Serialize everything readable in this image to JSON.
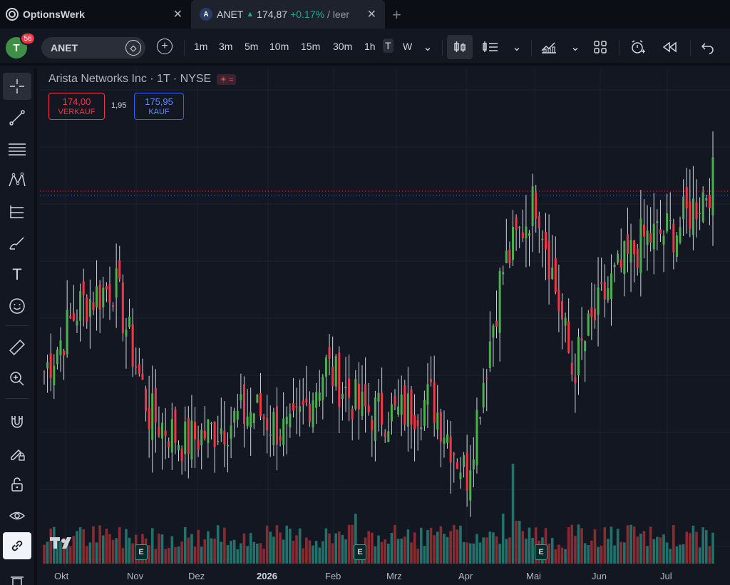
{
  "tabs": [
    {
      "title": "OptionsWerk"
    },
    {
      "symbol": "ANET",
      "price": "174,87",
      "change": "+0.17%",
      "extra": "/ leer"
    }
  ],
  "toolbar": {
    "avatar_letter": "T",
    "notifications": "56",
    "symbol": "ANET",
    "timeframes": [
      "1m",
      "3m",
      "5m",
      "10m",
      "15m",
      "30m",
      "1h",
      "T",
      "W"
    ],
    "active_timeframe": "T"
  },
  "chart": {
    "legend_title": "Arista Networks Inc · 1T · NYSE",
    "sell_price": "174,00",
    "sell_label": "VERKAUF",
    "spread": "1,95",
    "buy_price": "175,95",
    "buy_label": "KAUF",
    "watermark": "17",
    "x_labels": [
      "Okt",
      "Nov",
      "Dez",
      "2026",
      "Feb",
      "Mrz",
      "Apr",
      "Mai",
      "Jun",
      "Jul"
    ],
    "earnings_marker": "E"
  },
  "chart_data": {
    "type": "candlestick",
    "title": "Arista Networks Inc · 1T · NYSE",
    "x_labels": [
      "Okt",
      "Nov",
      "Dez",
      "2026",
      "Feb",
      "Mrz",
      "Apr",
      "Mai",
      "Jun",
      "Jul"
    ],
    "approx_close_trend": [
      {
        "month": "Okt",
        "close": 140
      },
      {
        "month": "Okt-mid",
        "close": 152
      },
      {
        "month": "Nov",
        "close": 156
      },
      {
        "month": "Nov-mid",
        "close": 132
      },
      {
        "month": "Dez",
        "close": 127
      },
      {
        "month": "Dez-mid",
        "close": 130
      },
      {
        "month": "2026",
        "close": 133
      },
      {
        "month": "Jan-mid",
        "close": 128
      },
      {
        "month": "Feb",
        "close": 141
      },
      {
        "month": "Feb-mid",
        "close": 133
      },
      {
        "month": "Mrz",
        "close": 132
      },
      {
        "month": "Mrz-mid",
        "close": 135
      },
      {
        "month": "Apr",
        "close": 121
      },
      {
        "month": "Apr-mid",
        "close": 158
      },
      {
        "month": "Mai",
        "close": 172
      },
      {
        "month": "Mai-mid",
        "close": 140
      },
      {
        "month": "Jun",
        "close": 155
      },
      {
        "month": "Jun-mid",
        "close": 164
      },
      {
        "month": "Jul",
        "close": 166
      },
      {
        "month": "Jul-end",
        "close": 174.87
      }
    ],
    "earnings_events": [
      "Nov",
      "Feb",
      "Mai"
    ],
    "last_price": 174.87,
    "change_pct": "+0.17%"
  }
}
